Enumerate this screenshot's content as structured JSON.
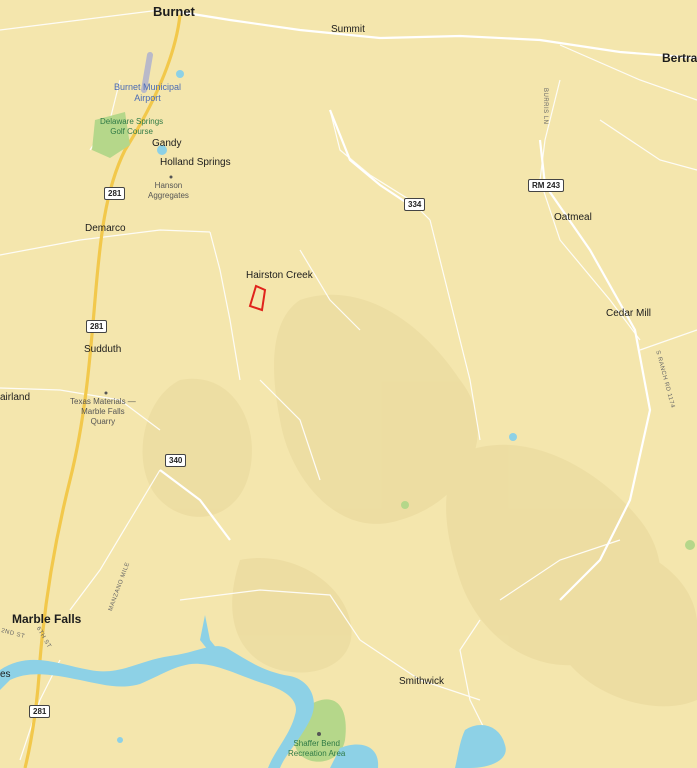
{
  "map": {
    "colors": {
      "land": "#f4e6ad",
      "terrain": "#e8d79a",
      "road": "#ffffff",
      "highway": "#f2c84b",
      "water": "#8dd1e6",
      "park": "#b5d78a",
      "parcel_outline": "#e0231c"
    },
    "places": {
      "burnet": "Burnet",
      "summit": "Summit",
      "bertram": "Bertra",
      "gandy": "Gandy",
      "holland_springs": "Holland Springs",
      "demarco": "Demarco",
      "oatmeal": "Oatmeal",
      "hairston_creek": "Hairston Creek",
      "cedar_mill": "Cedar Mill",
      "sudduth": "Sudduth",
      "fairland": "airland",
      "marble_falls": "Marble Falls",
      "smithwick": "Smithwick",
      "left_edge_es": "es"
    },
    "pois": {
      "airport_1": "Burnet Municipal",
      "airport_2": "Airport",
      "golf_1": "Delaware Springs",
      "golf_2": "Golf Course",
      "hanson_1": "Hanson",
      "hanson_2": "Aggregates",
      "quarry_1": "Texas Materials —",
      "quarry_2": "Marble Falls",
      "quarry_3": "Quarry",
      "shaffer_1": "Shaffer Bend",
      "shaffer_2": "Recreation Area"
    },
    "shields": {
      "us281_north": "281",
      "us281_mid": "281",
      "us281_south": "281",
      "fm334": "334",
      "rm243": "RM 243",
      "fm340": "340"
    },
    "streets": {
      "burris_ln": "BURRIS LN",
      "s_ranch_rd_1174": "S RANCH RD 1174",
      "manzano_mile": "MANZANO MILE",
      "second_st": "2ND ST",
      "sixth_st": "6TH ST"
    }
  }
}
